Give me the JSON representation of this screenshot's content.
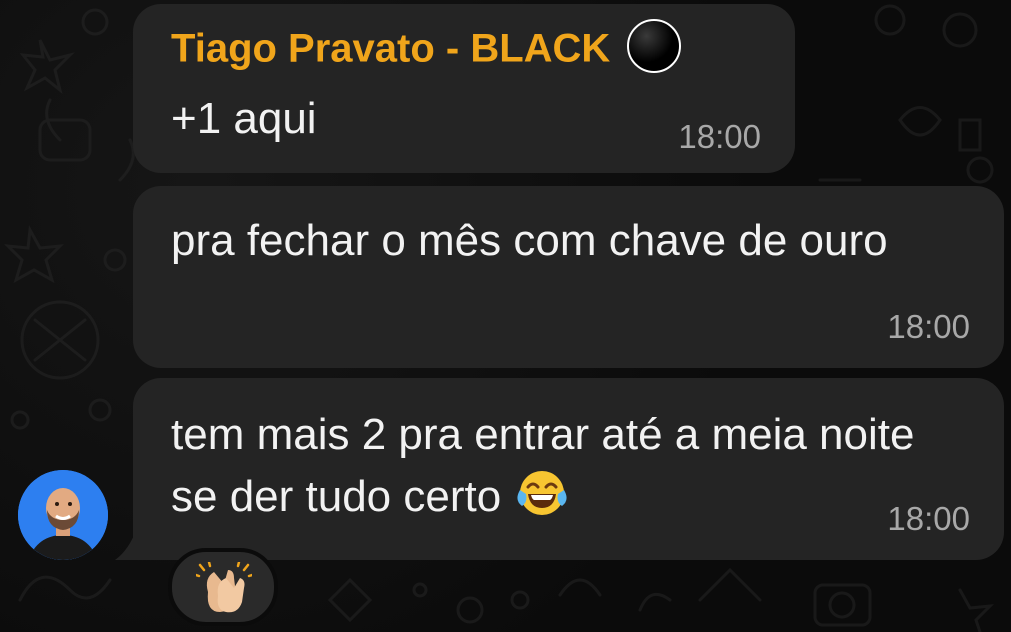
{
  "messages": [
    {
      "sender": "Tiago Pravato - BLACK",
      "sender_badge_icon": "black-circle-icon",
      "text": "+1 aqui",
      "time": "18:00"
    },
    {
      "text": "pra fechar o mês com chave de ouro",
      "time": "18:00"
    },
    {
      "text": "tem mais 2 pra entrar até a meia noite se der tudo certo",
      "emoji": "face-with-tears-of-joy-icon",
      "time": "18:00",
      "reaction": "clapping-hands-icon"
    }
  ],
  "colors": {
    "background": "#0b0b0b",
    "bubble": "#242424",
    "sender_name": "#f0a51b",
    "timestamp": "#a8a8a8",
    "avatar_bg": "#2d7ff0"
  }
}
